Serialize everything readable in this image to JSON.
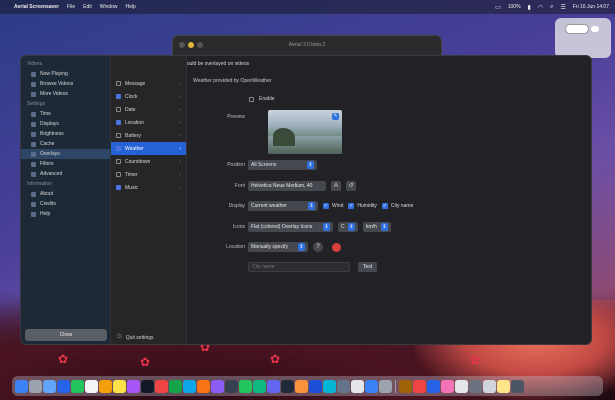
{
  "menubar": {
    "app_name": "Aerial Screensaver",
    "menus": [
      "File",
      "Edit",
      "Window",
      "Help"
    ],
    "status_battery": "100%",
    "clock": "Fri 16 Jun 14:07"
  },
  "bg_window": {
    "title": "Aerial 3.0 beta 2"
  },
  "sidebar": {
    "sections": [
      {
        "header": "Videos",
        "items": [
          {
            "label": "Now Playing",
            "icon": "play-icon"
          },
          {
            "label": "Browse Videos",
            "icon": "film-icon"
          },
          {
            "label": "More Videos",
            "icon": "plus-icon"
          }
        ]
      },
      {
        "header": "Settings",
        "items": [
          {
            "label": "Time",
            "icon": "clock-icon"
          },
          {
            "label": "Displays",
            "icon": "display-icon"
          },
          {
            "label": "Brightness",
            "icon": "sun-icon"
          },
          {
            "label": "Cache",
            "icon": "disk-icon"
          },
          {
            "label": "Overlays",
            "icon": "text-icon"
          },
          {
            "label": "Filters",
            "icon": "filter-icon"
          },
          {
            "label": "Advanced",
            "icon": "gear-icon"
          }
        ]
      },
      {
        "header": "Information",
        "items": [
          {
            "label": "About",
            "icon": "info-icon"
          },
          {
            "label": "Credits",
            "icon": "heart-icon"
          },
          {
            "label": "Help",
            "icon": "help-icon"
          }
        ]
      }
    ],
    "selected": "Overlays",
    "close_label": "Close"
  },
  "overlays_toggle_label": "Select which information should be overlayed on videos",
  "overlays_list": [
    {
      "label": "Message",
      "checked": false
    },
    {
      "label": "Clock",
      "checked": true
    },
    {
      "label": "Date",
      "checked": false
    },
    {
      "label": "Location",
      "checked": true
    },
    {
      "label": "Battery",
      "checked": false
    },
    {
      "label": "Weather",
      "checked": true
    },
    {
      "label": "Countdown",
      "checked": false
    },
    {
      "label": "Timer",
      "checked": false
    },
    {
      "label": "Music",
      "checked": true
    }
  ],
  "overlays_selected": "Weather",
  "weather": {
    "section_title": "Weather provided by OpenWeather",
    "enable_label": "Enable",
    "preview_label": "Preview",
    "position_label": "Position",
    "position_value": "All Screens",
    "font_label": "Font",
    "font_value": "Helvetica Neue Medium, 40",
    "display_label": "Display",
    "display_value": "Current weather",
    "wind_label": "Wind",
    "humidity_label": "Humidity",
    "city_name_label": "City name",
    "icons_label": "Icons",
    "icons_value": "Flat (colored) Overlay Icons",
    "degree_value": "C",
    "unit_value": "km/h",
    "location_label": "Location",
    "location_value": "Manually specify",
    "location_placeholder": "City name",
    "test_button_label": "Test"
  },
  "bottom": {
    "exit_label": "Quit settings"
  },
  "colors": {
    "accent": "#2f6fe0",
    "sidebar_bg": "#1e2937",
    "window_bg": "#222226"
  },
  "dock_count": 36
}
